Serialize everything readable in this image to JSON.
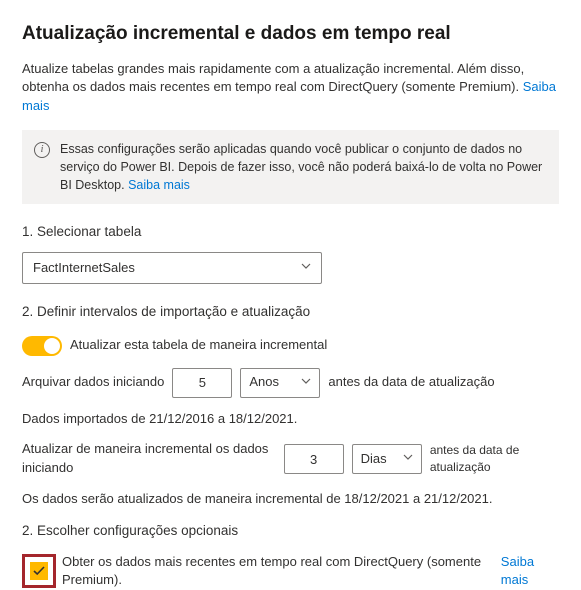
{
  "title": "Atualização incremental e dados em tempo real",
  "intro_text": "Atualize tabelas grandes mais rapidamente com a atualização incremental. Além disso, obtenha os dados mais recentes em tempo real com DirectQuery (somente Premium). ",
  "intro_link": "Saiba mais",
  "banner_text": "Essas configurações serão aplicadas quando você publicar o conjunto de dados no serviço do Power BI. Depois de fazer isso, você não poderá baixá-lo de volta no Power BI Desktop. ",
  "banner_link": "Saiba mais",
  "step1": {
    "label": "1. Selecionar tabela",
    "table_value": "FactInternetSales"
  },
  "step2": {
    "label": "2. Definir intervalos de importação e atualização",
    "toggle_label": "Atualizar esta tabela de maneira incremental",
    "archive_prefix": "Arquivar dados iniciando",
    "archive_value": "5",
    "archive_unit": "Anos",
    "archive_suffix": "antes da data de atualização",
    "imported_note": "Dados importados de 21/12/2016 a 18/12/2021.",
    "refresh_prefix": "Atualizar de maneira incremental os dados iniciando",
    "refresh_value": "3",
    "refresh_unit": "Dias",
    "refresh_suffix": "antes da data de atualização",
    "refresh_note": "Os dados serão atualizados de maneira incremental de 18/12/2021 a 21/12/2021."
  },
  "step3": {
    "label": "2. Escolher configurações opcionais",
    "option1_text": "Obter os dados mais recentes em tempo real com DirectQuery (somente Premium). ",
    "option1_link": "Saiba mais"
  }
}
